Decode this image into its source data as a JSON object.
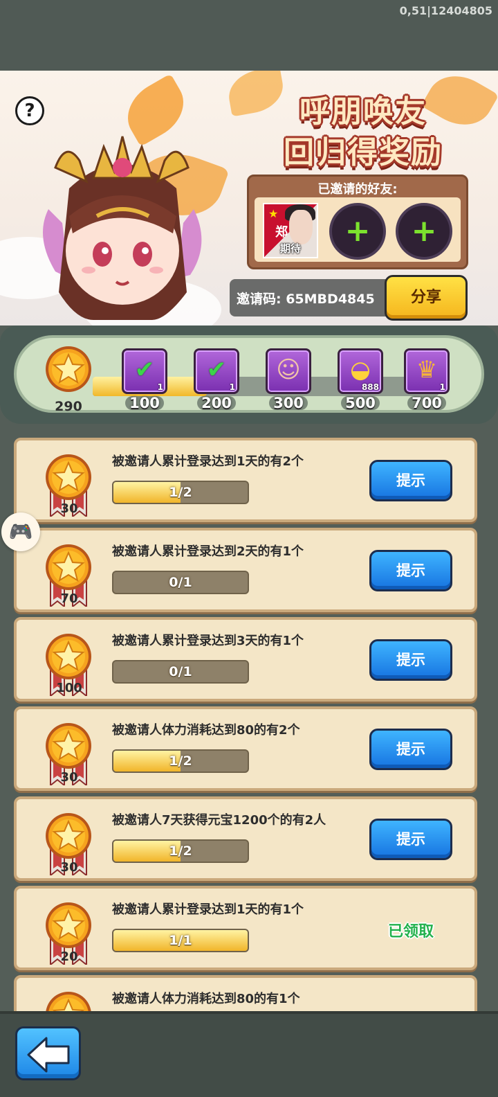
{
  "debug_text": "0,51|12404805",
  "banner": {
    "title_line1": "呼朋唤友",
    "title_line2": "回归得奖励",
    "help_icon": "question-mark-icon",
    "help_label": "?",
    "friends_title": "已邀请的好友:",
    "friend": {
      "name": "期待",
      "seal_text": "郑"
    },
    "empty_slot_icon": "plus-icon",
    "invite_code_text": "邀请码: 65MBD4845",
    "share_label": "分享"
  },
  "progress": {
    "total": "290",
    "fill_fraction": 0.33,
    "milestones": [
      {
        "value": "100",
        "icon": "checked-chest-icon",
        "count": "1"
      },
      {
        "value": "200",
        "icon": "checked-chest-icon",
        "count": "1"
      },
      {
        "value": "300",
        "icon": "hero-portrait-icon",
        "count": ""
      },
      {
        "value": "500",
        "icon": "gold-ingot-icon",
        "count": "888"
      },
      {
        "value": "700",
        "icon": "crown-icon",
        "count": "1"
      }
    ]
  },
  "tasks": [
    {
      "desc": "被邀请人累计登录达到1天的有2个",
      "progress_text": "1/2",
      "progress_fraction": 0.5,
      "reward": "30",
      "action": "提示",
      "status": "hint"
    },
    {
      "desc": "被邀请人累计登录达到2天的有1个",
      "progress_text": "0/1",
      "progress_fraction": 0,
      "reward": "70",
      "action": "提示",
      "status": "hint"
    },
    {
      "desc": "被邀请人累计登录达到3天的有1个",
      "progress_text": "0/1",
      "progress_fraction": 0,
      "reward": "100",
      "action": "提示",
      "status": "hint"
    },
    {
      "desc": "被邀请人体力消耗达到80的有2个",
      "progress_text": "1/2",
      "progress_fraction": 0.5,
      "reward": "30",
      "action": "提示",
      "status": "hint"
    },
    {
      "desc": "被邀请人7天获得元宝1200个的有2人",
      "progress_text": "1/2",
      "progress_fraction": 0.5,
      "reward": "30",
      "action": "提示",
      "status": "hint"
    },
    {
      "desc": "被邀请人累计登录达到1天的有1个",
      "progress_text": "1/1",
      "progress_fraction": 1,
      "reward": "20",
      "action": "已领取",
      "status": "claimed"
    },
    {
      "desc": "被邀请人体力消耗达到80的有1个",
      "progress_text": "",
      "progress_fraction": 1,
      "reward": "",
      "action": "",
      "status": "claimed"
    }
  ],
  "floating_icon": "gamepad-icon",
  "back_icon": "back-arrow-icon",
  "colors": {
    "accent_blue": "#1d86e6",
    "accent_yellow": "#f5b51d",
    "claimed_green": "#22b14c"
  }
}
